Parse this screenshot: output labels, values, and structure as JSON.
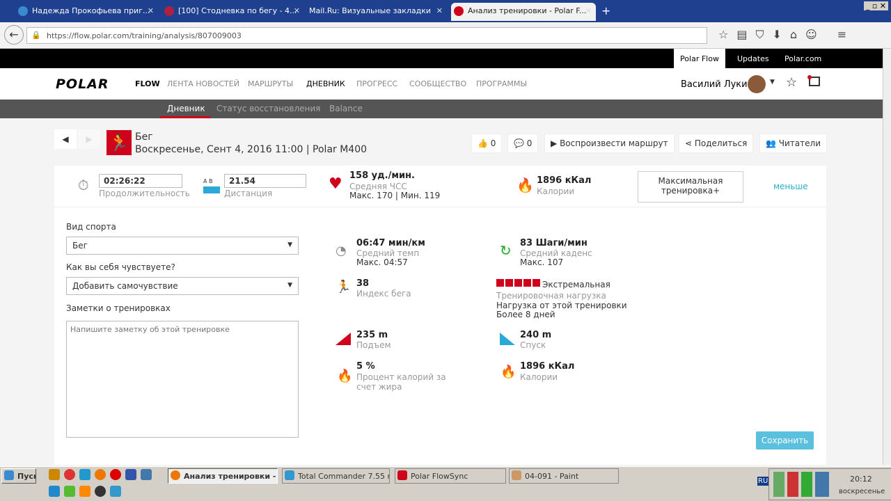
{
  "browser": {
    "tabs": [
      "Надежда Прокофьева приг...",
      "[100] Стодневка по бегу - 4...",
      "Mail.Ru: Визуальные закладки",
      "Анализ тренировки - Polar F..."
    ],
    "url": "https://flow.polar.com/training/analysis/807009003"
  },
  "topbar": {
    "links": [
      "Polar Flow",
      "Updates",
      "Polar.com"
    ]
  },
  "header": {
    "logo": "POLAR",
    "flow": "FLOW",
    "nav": [
      "ЛЕНТА НОВОСТЕЙ",
      "МАРШРУТЫ",
      "ДНЕВНИК",
      "ПРОГРЕСС",
      "СООБЩЕСТВО",
      "ПРОГРАММЫ"
    ],
    "active_nav": "ДНЕВНИК",
    "user": "Василий Лукин"
  },
  "subnav": [
    "Дневник",
    "Статус восстановления",
    "Balance"
  ],
  "session": {
    "sport": "Бег",
    "datetime": "Воскресенье, Сент 4, 2016 11:00 | Polar M400",
    "likes": "0",
    "comments": "0",
    "replay": "Воспроизвести маршрут",
    "share": "Поделиться",
    "readers": "Читатели"
  },
  "summary": {
    "duration": "02:26:22",
    "duration_label": "Продолжительность",
    "ab": "A  B",
    "distance": "21.54",
    "distance_label": "Дистанция",
    "hr": "158 уд./мин.",
    "hr_label": "Средняя ЧСС",
    "hr_minmax": "Макс. 170  |  Мин. 119",
    "calories": "1896 кКал",
    "calories_label": "Калории",
    "max_training": "Максимальная тренировка+",
    "less": "меньше"
  },
  "form": {
    "sport_label": "Вид спорта",
    "sport_value": "Бег",
    "feeling_label": "Как вы себя чувствуете?",
    "feeling_value": "Добавить самочувствие",
    "notes_label": "Заметки о тренировках",
    "notes_placeholder": "Напишите заметку об этой тренировке",
    "save": "Сохранить"
  },
  "stats": {
    "pace": "06:47 мин/км",
    "pace_label": "Средний темп",
    "pace_max": "Макс. 04:57",
    "cadence": "83 Шаги/мин",
    "cadence_label": "Средний каденс",
    "cadence_max": "Макс. 107",
    "running_index": "38",
    "running_index_label": "Индекс бега",
    "load": "Экстремальная",
    "load_label": "Тренировочная нагрузка",
    "load_desc": "Нагрузка от этой тренировки",
    "load_time": "Более 8 дней",
    "load_level": 5,
    "ascent": "235 m",
    "ascent_label": "Подъем",
    "descent": "240 m",
    "descent_label": "Спуск",
    "fat": "5 %",
    "fat_label": "Процент калорий за счет жира",
    "cal": "1896 кКал",
    "cal_label": "Калории"
  },
  "taskbar": {
    "start": "Пуск",
    "windows": [
      "Анализ тренировки - ...",
      "Total Commander 7.55 r...",
      "Polar FlowSync",
      "04-091 - Paint"
    ],
    "lang": "RU",
    "time": "20:12",
    "day": "воскресенье"
  },
  "colors": {
    "polar_red": "#d0021b",
    "save": "#5bc0de",
    "link": "#2bb0c8"
  }
}
